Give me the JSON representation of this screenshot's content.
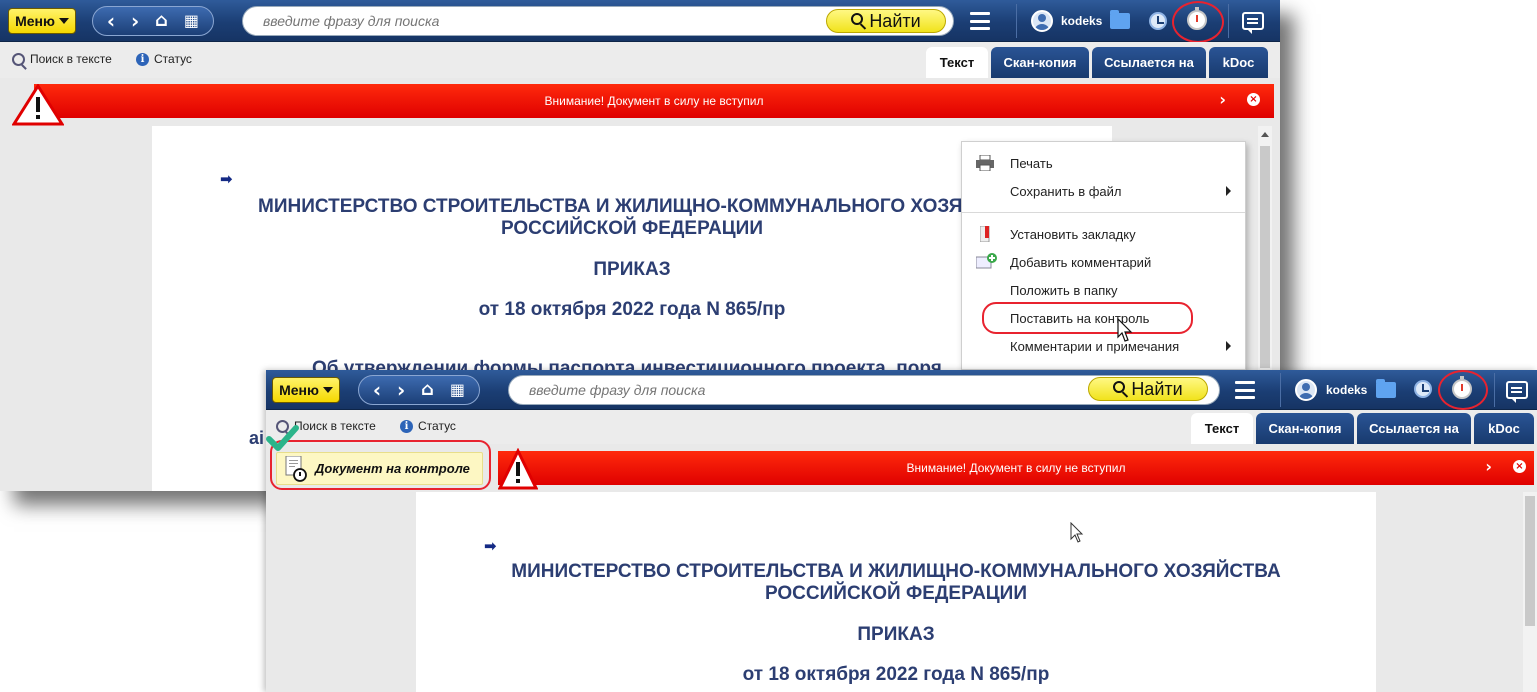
{
  "app": {
    "menu_label": "Меню",
    "search_placeholder": "введите фразу для поиска",
    "find_label": "Найти",
    "user_name": "kodeks"
  },
  "toolbar": {
    "search_in_text": "Поиск в тексте",
    "status": "Статус"
  },
  "tabs": [
    {
      "label": "Текст",
      "active": true
    },
    {
      "label": "Скан-копия",
      "active": false
    },
    {
      "label": "Ссылается на",
      "active": false
    },
    {
      "label": "kDoc",
      "active": false
    }
  ],
  "warning": {
    "text": "Внимание! Документ в силу не вступил",
    "arrow": "›",
    "close": "×",
    "color": "#e80000"
  },
  "document": {
    "ministry_line1": "МИНИСТЕРСТВО СТРОИТЕЛЬСТВА И ЖИЛИЩНО-КОММУНАЛЬНОГО ХОЗЯЙСТВА",
    "ministry_line1_cut": "МИНИСТЕРСТВО СТРОИТЕЛЬСТВА И ЖИЛИЩНО-КОММУНАЛЬНОГО ХОЗЯ",
    "ministry_line2": "РОССИЙСКОЙ ФЕДЕРАЦИИ",
    "doc_type": "ПРИКАЗ",
    "date_number": "от 18 октября 2022 года N 865/пр",
    "title_partial": "Об утверждении формы паспорта инвестиционного проекта, поря",
    "fragment": "аі"
  },
  "context_menu": {
    "items": [
      {
        "label": "Печать",
        "icon": "printer-icon",
        "submenu": false
      },
      {
        "label": "Сохранить в файл",
        "icon": "",
        "submenu": true
      },
      {
        "label": "Установить закладку",
        "icon": "bookmark-icon",
        "submenu": false
      },
      {
        "label": "Добавить комментарий",
        "icon": "add-comment-icon",
        "submenu": false
      },
      {
        "label": "Положить в папку",
        "icon": "",
        "submenu": false
      },
      {
        "label": "Поставить на контроль",
        "icon": "",
        "submenu": false
      },
      {
        "label": "Комментарии и примечания",
        "icon": "",
        "submenu": true
      }
    ]
  },
  "control_badge": {
    "label": "Документ на контроле"
  },
  "colors": {
    "topbar": "#1b3e74",
    "highlight_ring": "#e8232f",
    "menu_button": "#f5d800",
    "check": "#2bb48a"
  }
}
